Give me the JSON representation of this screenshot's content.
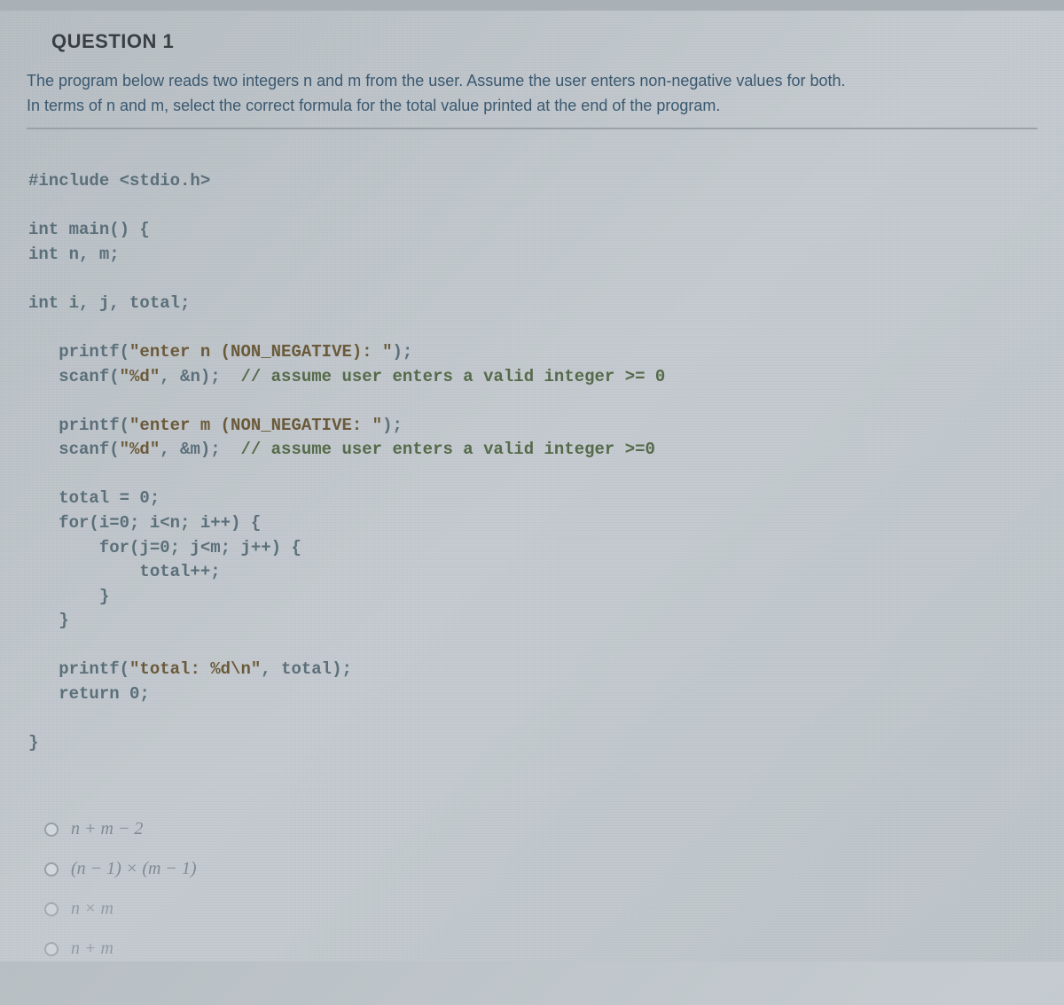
{
  "question": {
    "title": "QUESTION 1",
    "prompt_line1": "The program below reads two integers n and m from the user.  Assume the user enters non-negative values for both.",
    "prompt_line2": "In terms of n and m, select the correct formula for the total value printed at the end of the program."
  },
  "code": {
    "l01": "#include <stdio.h>",
    "l02": "",
    "l03": "int main() {",
    "l04": "int n, m;",
    "l05": "",
    "l06": "int i, j, total;",
    "l07": "",
    "l08a": "   printf(",
    "l08s": "\"enter n (NON_NEGATIVE): \"",
    "l08b": ");",
    "l09a": "   scanf(",
    "l09s": "\"%d\"",
    "l09b": ", &n);  ",
    "l09c": "// assume user enters a valid integer >= 0",
    "l10": "",
    "l11a": "   printf(",
    "l11s": "\"enter m (NON_NEGATIVE: \"",
    "l11b": ");",
    "l12a": "   scanf(",
    "l12s": "\"%d\"",
    "l12b": ", &m);  ",
    "l12c": "// assume user enters a valid integer >=0",
    "l13": "",
    "l14": "   total = 0;",
    "l15": "   for(i=0; i<n; i++) {",
    "l16": "       for(j=0; j<m; j++) {",
    "l17": "           total++;",
    "l18": "       }",
    "l19": "   }",
    "l20": "",
    "l21a": "   printf(",
    "l21s": "\"total: %d\\n\"",
    "l21b": ", total);",
    "l22": "   return 0;",
    "l23": "",
    "l24": "}"
  },
  "answers": {
    "a1": "n + m − 2",
    "a2": "(n − 1) × (m − 1)",
    "a3": "n × m",
    "a4": "n + m"
  }
}
